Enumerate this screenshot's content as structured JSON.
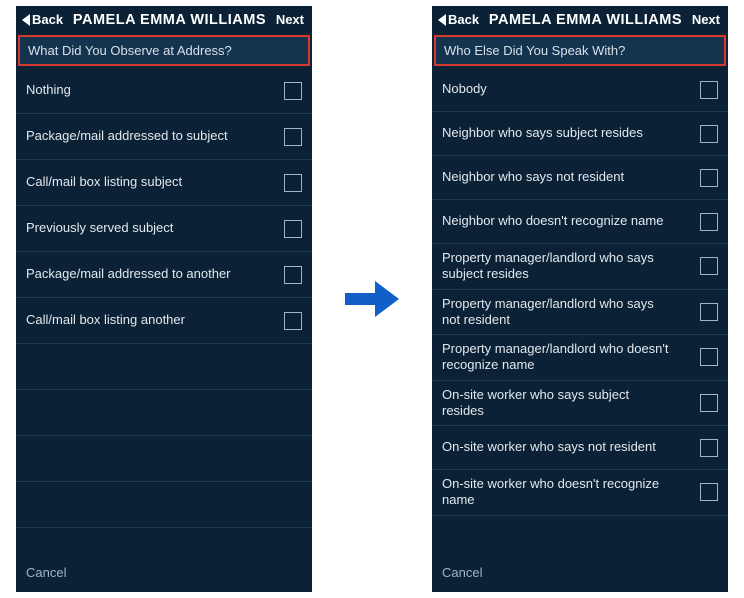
{
  "colors": {
    "accent_arrow": "#1160c9",
    "highlight_border": "#d63a2f",
    "bg": "#0b2236"
  },
  "screens": [
    {
      "back_label": "Back",
      "title": "PAMELA EMMA WILLIAMS",
      "next_label": "Next",
      "section_header": "What Did You Observe at Address?",
      "cancel_label": "Cancel",
      "items": [
        "Nothing",
        "Package/mail addressed to subject",
        "Call/mail box listing subject",
        "Previously served subject",
        "Package/mail addressed to another",
        "Call/mail box listing another"
      ],
      "blank_rows": 4
    },
    {
      "back_label": "Back",
      "title": "PAMELA EMMA WILLIAMS",
      "next_label": "Next",
      "section_header": "Who Else Did You Speak With?",
      "cancel_label": "Cancel",
      "items": [
        "Nobody",
        "Neighbor who says subject resides",
        "Neighbor who says not resident",
        "Neighbor who doesn't recognize name",
        "Property manager/landlord who says subject resides",
        "Property manager/landlord who says not resident",
        "Property manager/landlord who doesn't recognize name",
        "On-site worker who says subject resides",
        "On-site worker who says not resident",
        "On-site worker who doesn't recognize name"
      ],
      "blank_rows": 0
    }
  ]
}
